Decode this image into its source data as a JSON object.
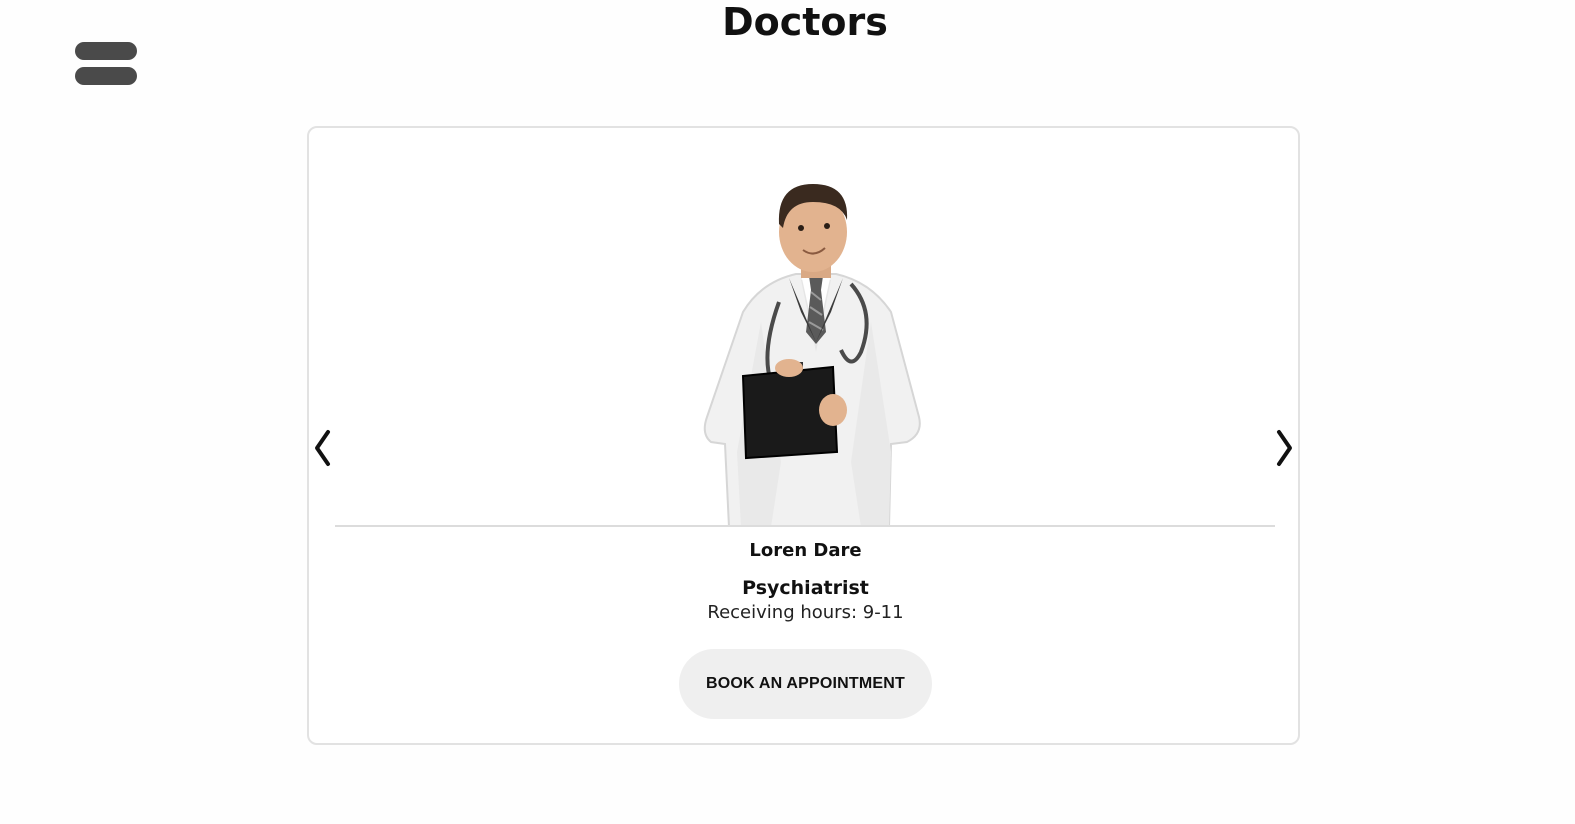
{
  "header": {
    "title": "Doctors",
    "menu_icon": "hamburger-menu-icon"
  },
  "carousel": {
    "prev_icon": "chevron-left-icon",
    "next_icon": "chevron-right-icon",
    "slide": {
      "photo": "doctor-portrait",
      "name": "Loren Dare",
      "specialty": "Psychiatrist",
      "hours_text": "Receiving hours: 9-11",
      "button_label": "BOOK AN APPOINTMENT"
    }
  },
  "colors": {
    "background": "#fefefe",
    "menu_bar": "#4a4a4a",
    "card_border": "#e2e2e2",
    "button_bg": "#efefef",
    "text": "#111111"
  }
}
